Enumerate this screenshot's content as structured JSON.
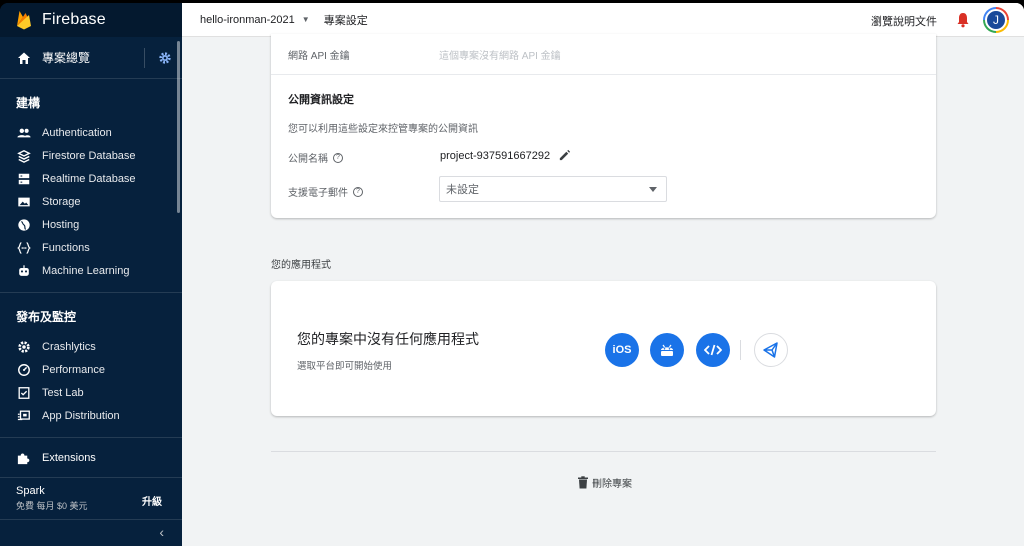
{
  "sidebar": {
    "brand": "Firebase",
    "overview": "專案總覽",
    "sections": [
      {
        "title": "建構",
        "items": [
          {
            "label": "Authentication",
            "icon": "people-icon"
          },
          {
            "label": "Firestore Database",
            "icon": "firestore-icon"
          },
          {
            "label": "Realtime Database",
            "icon": "database-icon"
          },
          {
            "label": "Storage",
            "icon": "image-icon"
          },
          {
            "label": "Hosting",
            "icon": "globe-icon"
          },
          {
            "label": "Functions",
            "icon": "functions-icon"
          },
          {
            "label": "Machine Learning",
            "icon": "robot-icon"
          }
        ]
      },
      {
        "title": "發布及監控",
        "items": [
          {
            "label": "Crashlytics",
            "icon": "crashlytics-icon"
          },
          {
            "label": "Performance",
            "icon": "speedometer-icon"
          },
          {
            "label": "Test Lab",
            "icon": "checklist-icon"
          },
          {
            "label": "App Distribution",
            "icon": "distribution-icon"
          }
        ]
      }
    ],
    "extensions": "Extensions",
    "plan": {
      "name": "Spark",
      "price": "免費 每月 $0 美元",
      "upgrade": "升級"
    },
    "collapse": "‹"
  },
  "topbar": {
    "project": "hello-ironman-2021",
    "page": "專案設定",
    "docs": "瀏覽說明文件",
    "avatar": "J"
  },
  "settings": {
    "api_key_label": "網路 API 金鑰",
    "api_key_value": "這個專案沒有網路 API 金鑰",
    "public_title": "公開資訊設定",
    "public_desc": "您可以利用這些設定來控管專案的公開資訊",
    "public_name_label": "公開名稱",
    "public_name_value": "project-937591667292",
    "support_email_label": "支援電子郵件",
    "support_email_value": "未設定"
  },
  "apps": {
    "section_label": "您的應用程式",
    "heading": "您的專案中沒有任何應用程式",
    "sub": "選取平台即可開始使用",
    "ios": "iOS"
  },
  "delete_label": "刪除專案",
  "colors": {
    "sidebar": "#06213d",
    "accent": "#1a73e8",
    "background": "#f1f3f4"
  }
}
